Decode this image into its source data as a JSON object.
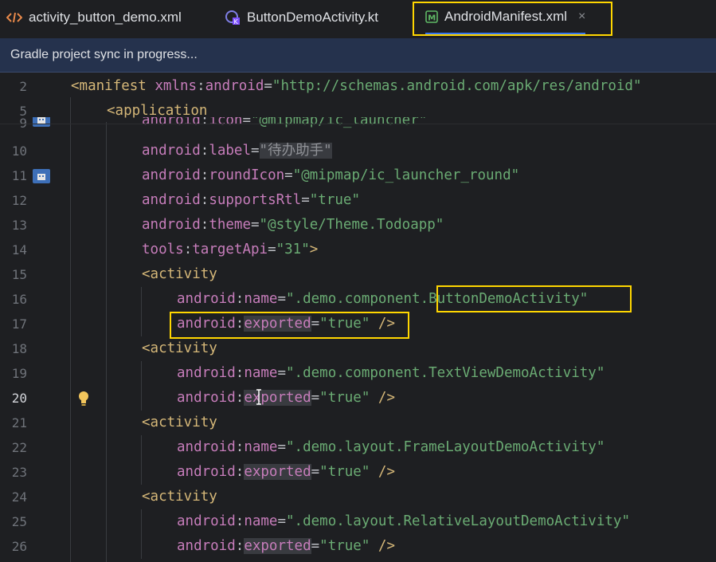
{
  "tabs": [
    {
      "label": "activity_button_demo.xml",
      "icon": "xml-tag-icon"
    },
    {
      "label": "ButtonDemoActivity.kt",
      "icon": "kotlin-class-icon"
    },
    {
      "label": "AndroidManifest.xml",
      "icon": "manifest-icon",
      "close": "×"
    }
  ],
  "banner": {
    "text": "Gradle project sync in progress..."
  },
  "lines": {
    "l2": "2",
    "l5": "5",
    "l9": "9",
    "l10": "10",
    "l11": "11",
    "l12": "12",
    "l13": "13",
    "l14": "14",
    "l15": "15",
    "l16": "16",
    "l17": "17",
    "l18": "18",
    "l19": "19",
    "l20": "20",
    "l21": "21",
    "l22": "22",
    "l23": "23",
    "l24": "24",
    "l25": "25",
    "l26": "26"
  },
  "code": {
    "manifest_tag": "<manifest",
    "xmlns": "xmlns",
    "android_ns": "android",
    "schema_url": "\"http://schemas.android.com/apk/res/android\"",
    "application_tag": "<application",
    "icon_attr": "icon",
    "icon_val": "\"@mipmap/ic_launcher\"",
    "label_attr": "label",
    "label_q1": "\"",
    "label_cn": "待办助手",
    "label_q2": "\"",
    "roundicon_attr": "roundIcon",
    "roundicon_val": "\"@mipmap/ic_launcher_round\"",
    "supportsrtl_attr": "supportsRtl",
    "supportsrtl_val": "\"true\"",
    "theme_attr": "theme",
    "theme_val": "\"@style/Theme.Todoapp\"",
    "tools_ns": "tools",
    "targetapi_attr": "targetApi",
    "targetapi_val": "\"31\"",
    "activity_tag": "<activity",
    "name_attr": "name",
    "exported_attr": "exported",
    "true_val": "\"true\"",
    "close_tag": "/>",
    "act1_prefix": "\".demo.component.",
    "act1_name": "ButtonDemoActivity\"",
    "act2": "\".demo.component.TextViewDemoActivity\"",
    "act3": "\".demo.layout.FrameLayoutDemoActivity\"",
    "act4": "\".demo.layout.RelativeLayoutDemoActivity\""
  }
}
